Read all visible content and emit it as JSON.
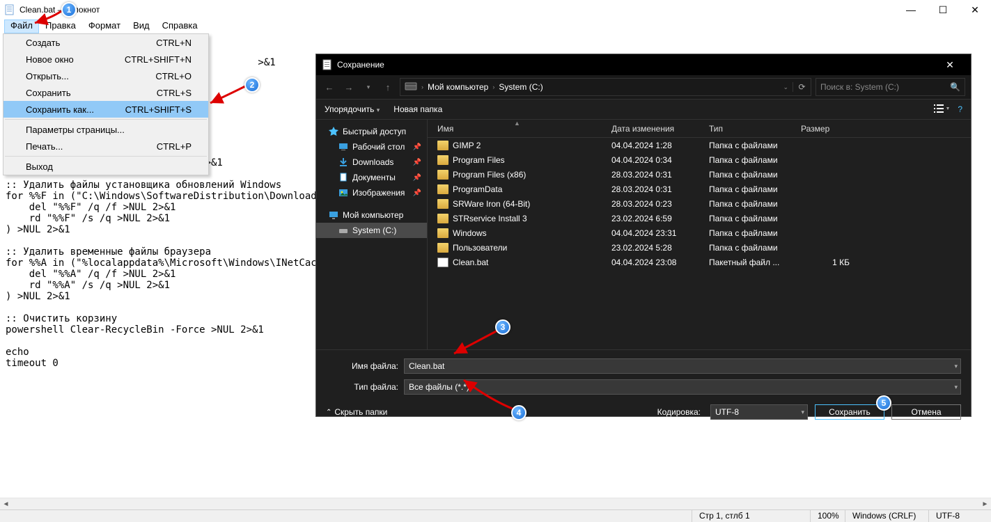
{
  "window": {
    "title": "Clean.bat — Блокнот",
    "menus": [
      "Файл",
      "Правка",
      "Формат",
      "Вид",
      "Справка"
    ],
    "controls": {
      "min": "—",
      "max": "☐",
      "close": "✕"
    }
  },
  "dropdown": {
    "items": [
      {
        "label": "Создать",
        "shortcut": "CTRL+N"
      },
      {
        "label": "Новое окно",
        "shortcut": "CTRL+SHIFT+N"
      },
      {
        "label": "Открыть...",
        "shortcut": "CTRL+O"
      },
      {
        "label": "Сохранить",
        "shortcut": "CTRL+S"
      },
      {
        "label": "Сохранить как...",
        "shortcut": "CTRL+SHIFT+S",
        "hi": true
      },
      {
        "sep": true
      },
      {
        "label": "Параметры страницы..."
      },
      {
        "label": "Печать...",
        "shortcut": "CTRL+P"
      },
      {
        "sep": true
      },
      {
        "label": "Выход"
      }
    ]
  },
  "editor": {
    "text": "\n\n                                           >&1\n\n\n\n\n\n\n\n:: Удалить логи Windir\ndel /s /f /q %windir%\\*.log >NUL 2>&1\n\n:: Удалить файлы установщика обновлений Windows\nfor %%F in (\"C:\\Windows\\SoftwareDistribution\\Download\\*\") do (\n    del \"%%F\" /q /f >NUL 2>&1\n    rd \"%%F\" /s /q >NUL 2>&1\n) >NUL 2>&1\n\n:: Удалить временные файлы браузера\nfor %%A in (\"%localappdata%\\Microsoft\\Windows\\INetCache\\*\") do (\n    del \"%%A\" /q /f >NUL 2>&1\n    rd \"%%A\" /s /q >NUL 2>&1\n) >NUL 2>&1\n\n:: Очистить корзину\npowershell Clear-RecycleBin -Force >NUL 2>&1\n\necho\ntimeout 0"
  },
  "statusbar": {
    "pos": "Стр 1, стлб 1",
    "zoom": "100%",
    "eol": "Windows (CRLF)",
    "enc": "UTF-8"
  },
  "savedlg": {
    "title": "Сохранение",
    "path": {
      "seg1": "Мой компьютер",
      "seg2": "System (C:)"
    },
    "search_ph": "Поиск в: System (C:)",
    "tools": {
      "organize": "Упорядочить",
      "newfolder": "Новая папка"
    },
    "tree": {
      "quick": "Быстрый доступ",
      "desktop": "Рабочий стол",
      "downloads": "Downloads",
      "documents": "Документы",
      "images": "Изображения",
      "mypc": "Мой компьютер",
      "system": "System (C:)"
    },
    "cols": {
      "name": "Имя",
      "date": "Дата изменения",
      "type": "Тип",
      "size": "Размер"
    },
    "rows": {
      "0": {
        "name": "GIMP 2",
        "date": "04.04.2024 1:28",
        "type": "Папка с файлами",
        "size": "",
        "kind": "folder"
      },
      "1": {
        "name": "Program Files",
        "date": "04.04.2024 0:34",
        "type": "Папка с файлами",
        "size": "",
        "kind": "folder"
      },
      "2": {
        "name": "Program Files (x86)",
        "date": "28.03.2024 0:31",
        "type": "Папка с файлами",
        "size": "",
        "kind": "folder"
      },
      "3": {
        "name": "ProgramData",
        "date": "28.03.2024 0:31",
        "type": "Папка с файлами",
        "size": "",
        "kind": "folder"
      },
      "4": {
        "name": "SRWare Iron (64-Bit)",
        "date": "28.03.2024 0:23",
        "type": "Папка с файлами",
        "size": "",
        "kind": "folder"
      },
      "5": {
        "name": "STRservice Install 3",
        "date": "23.02.2024 6:59",
        "type": "Папка с файлами",
        "size": "",
        "kind": "folder"
      },
      "6": {
        "name": "Windows",
        "date": "04.04.2024 23:31",
        "type": "Папка с файлами",
        "size": "",
        "kind": "folder"
      },
      "7": {
        "name": "Пользователи",
        "date": "23.02.2024 5:28",
        "type": "Папка с файлами",
        "size": "",
        "kind": "folder"
      },
      "8": {
        "name": "Clean.bat",
        "date": "04.04.2024 23:08",
        "type": "Пакетный файл ...",
        "size": "1 КБ",
        "kind": "bat"
      }
    },
    "form": {
      "name_label": "Имя файла:",
      "name_value": "Clean.bat",
      "type_label": "Тип файла:",
      "type_value": "Все файлы  (*.*)"
    },
    "footer": {
      "hide": "Скрыть папки",
      "enc_label": "Кодировка:",
      "enc_value": "UTF-8",
      "save": "Сохранить",
      "cancel": "Отмена"
    }
  },
  "callouts": {
    "1": "1",
    "2": "2",
    "3": "3",
    "4": "4",
    "5": "5"
  }
}
